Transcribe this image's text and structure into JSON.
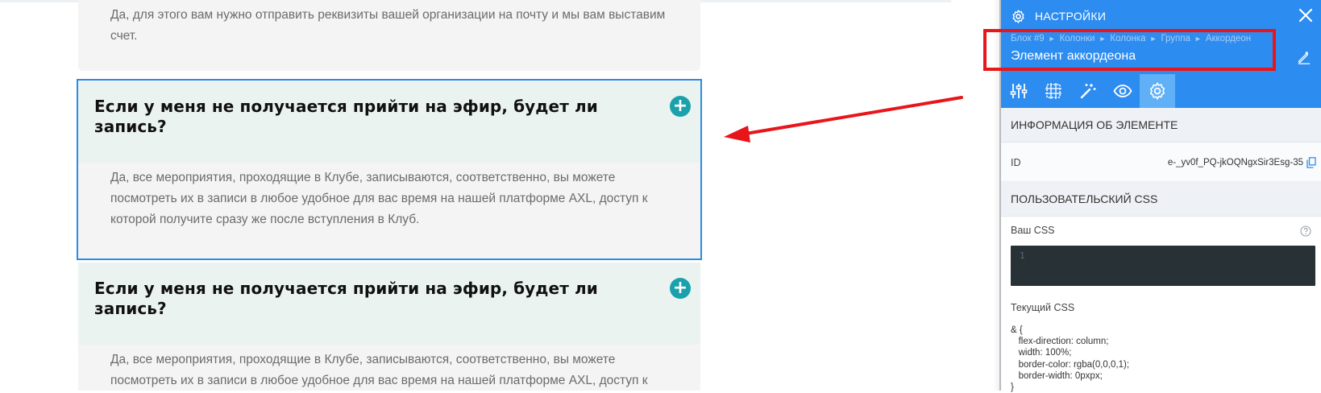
{
  "canvas": {
    "prev_answer": "Да, для этого вам нужно отправить реквизиты вашей организации на почту  и мы вам выставим счет.",
    "items": [
      {
        "question": "Если у меня не получается прийти на эфир, будет ли запись?",
        "answer": "Да, все мероприятия, проходящие в Клубе, записываются, соответственно, вы можете посмотреть их в записи в любое удобное для вас время на нашей платформе AXL, доступ к которой получите сразу же после вступления в Клуб.",
        "toggle_symbol": "+"
      },
      {
        "question": "Если у меня не получается прийти на эфир, будет ли запись?",
        "answer": "Да, все мероприятия, проходящие в Клубе, записываются, соответственно, вы можете посмотреть их в записи в любое удобное для вас время на нашей платформе AXL, доступ к которой получите сразу же после вступления в Клуб.",
        "toggle_symbol": "+"
      }
    ]
  },
  "panel": {
    "title": "НАСТРОЙКИ",
    "breadcrumbs": [
      "Блок #9",
      "Колонки",
      "Колонка",
      "Группа",
      "Аккордеон"
    ],
    "breadcrumb_separator": "►",
    "element_name": "Элемент аккордеона",
    "tabs": [
      {
        "icon": "sliders-icon",
        "active": false
      },
      {
        "icon": "layout-grid-icon",
        "active": false
      },
      {
        "icon": "magic-wand-icon",
        "active": false
      },
      {
        "icon": "eye-icon",
        "active": false
      },
      {
        "icon": "gear-icon",
        "active": true
      }
    ],
    "info_section": {
      "heading": "ИНФОРМАЦИЯ ОБ ЭЛЕМЕНТЕ",
      "id_label": "ID",
      "id_value": "e-_yv0f_PQ-jkOQNgxSir3Esg-35"
    },
    "css_section": {
      "heading": "ПОЛЬЗОВАТЕЛЬСКИЙ CSS",
      "your_css_label": "Ваш CSS",
      "editor_line_number": "1",
      "editor_value": "",
      "current_css_label": "Текущий CSS",
      "current_css": "& {\n   flex-direction: column;\n   width: 100%;\n   border-color: rgba(0,0,0,1);\n   border-width: 0pxpx;\n}"
    }
  },
  "colors": {
    "accent": "#2d8cf0",
    "active_tab": "#5fb0f7",
    "annotation_red": "#e8151a",
    "toggle_teal": "#1aa1ab",
    "selection_outline": "#2a8be5"
  }
}
